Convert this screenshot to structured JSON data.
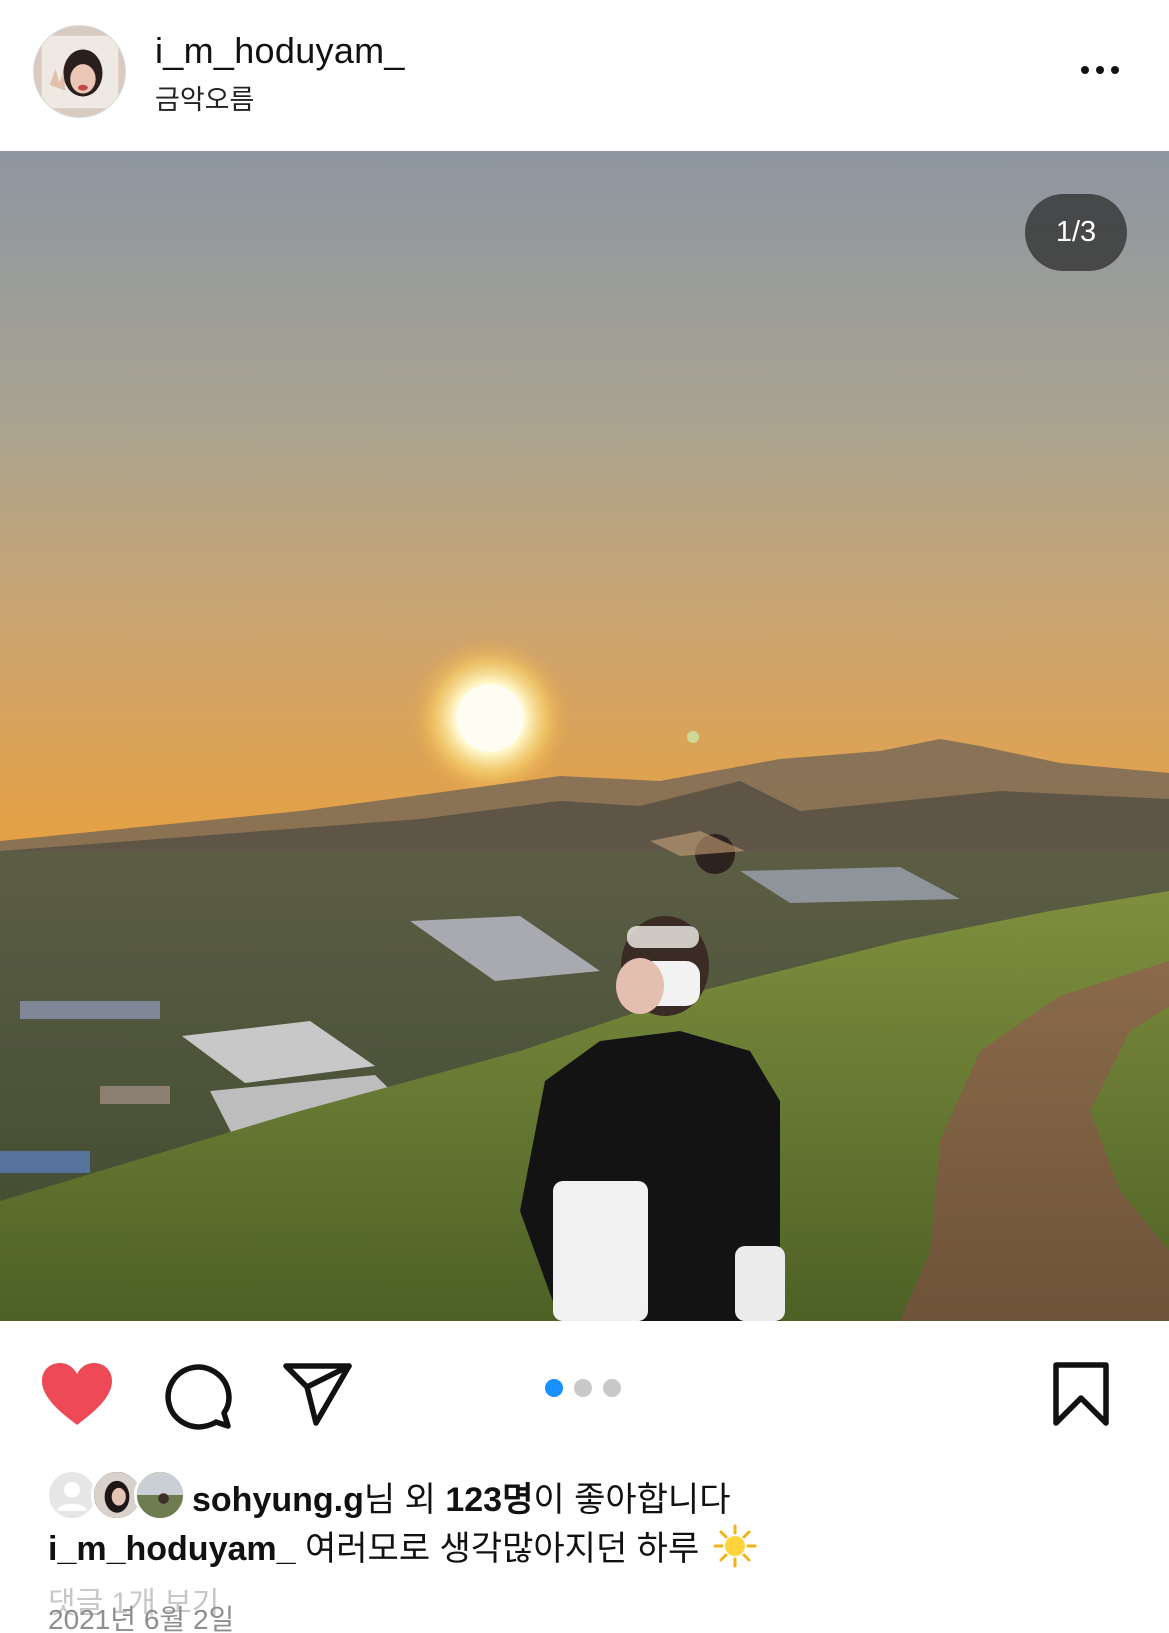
{
  "header": {
    "username": "i_m_hoduyam_",
    "location": "금악오름",
    "avatar_icon": "profile-avatar",
    "more_icon": "more-horizontal-icon"
  },
  "photo": {
    "counter": "1/3",
    "current_index": 1,
    "total": 3,
    "alt_description": ""
  },
  "actions": {
    "liked": true,
    "heart_icon": "heart-filled-icon",
    "comment_icon": "comment-bubble-icon",
    "share_icon": "paper-plane-icon",
    "bookmark_icon": "bookmark-icon",
    "colors": {
      "heart": "#ed4956",
      "dot_active": "#1990ff",
      "dot_inactive": "#c8c8c8"
    }
  },
  "likes": {
    "liker": "sohyung.g",
    "suffix1": "님 외 ",
    "count": "123명",
    "suffix2": "이 좋아합니다"
  },
  "caption": {
    "username": "i_m_hoduyam_",
    "text": "여러모로 생각많아지던 하루",
    "emoji_icon": "sun-emoji-icon"
  },
  "comments": {
    "view_all": "댓글 1개 보기"
  },
  "date": "2021년 6월 2일"
}
